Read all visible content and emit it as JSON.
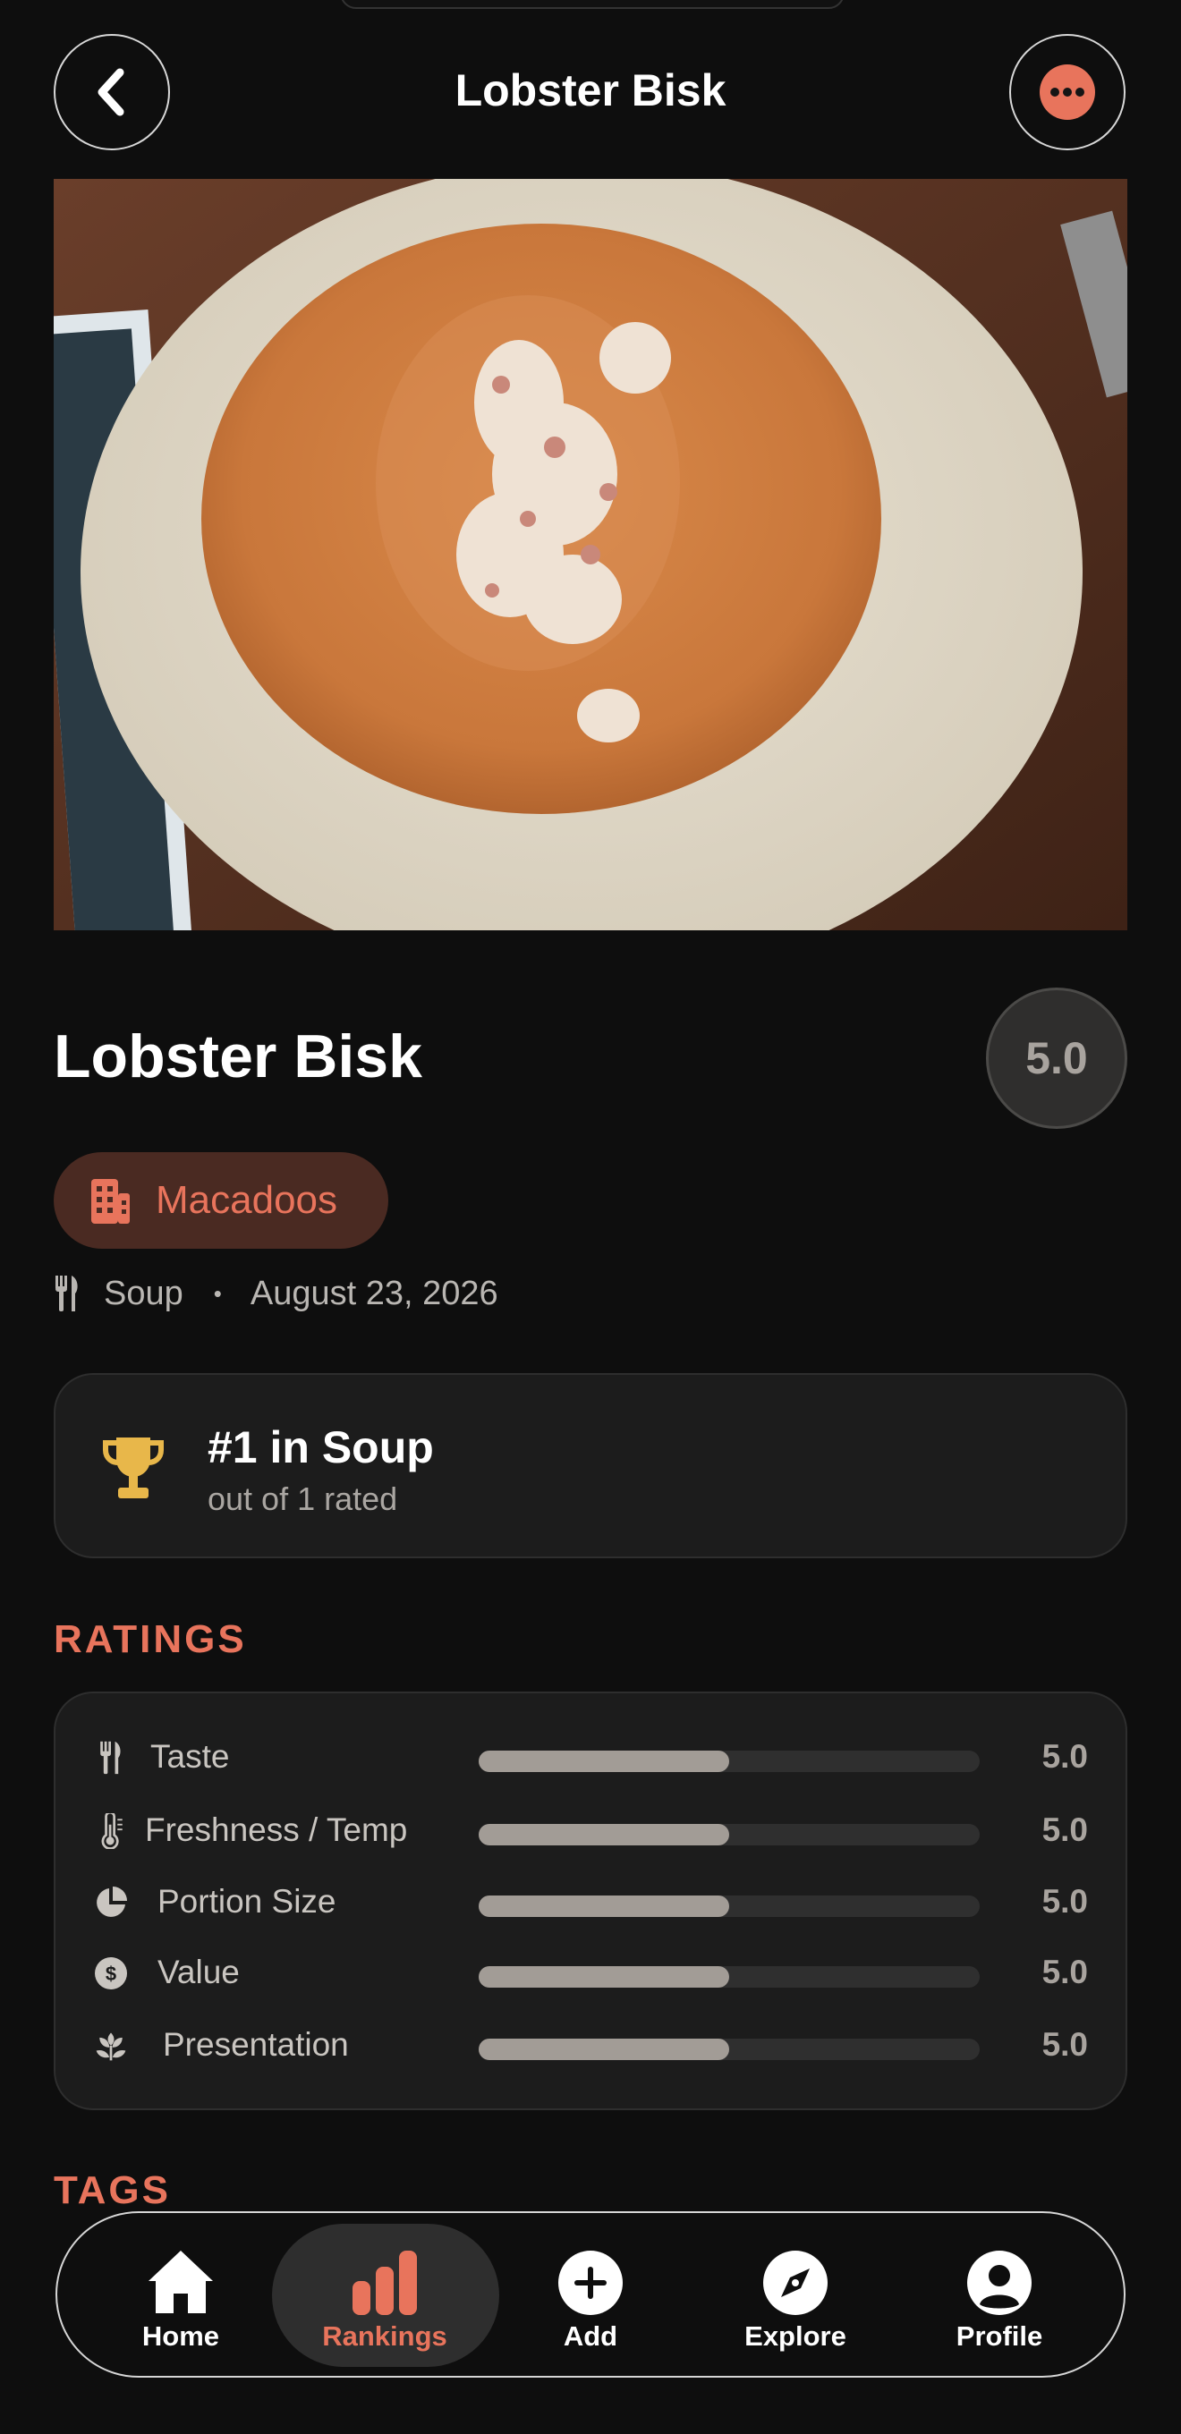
{
  "header": {
    "title": "Lobster Bisk",
    "back_icon": "chevron-left-icon",
    "more_icon": "ellipsis-icon"
  },
  "photo": {
    "description_icon": "food-photo"
  },
  "dish": {
    "name": "Lobster Bisk",
    "score": "5.0"
  },
  "place": {
    "name": "Macadoos",
    "icon": "building-icon"
  },
  "meta": {
    "category": "Soup",
    "separator": "•",
    "date": "August 23, 2026"
  },
  "ranking": {
    "title": "#1 in Soup",
    "subtitle": "out of 1 rated"
  },
  "ratings": {
    "heading": "RATINGS",
    "items": [
      {
        "label": "Taste",
        "value": "5.0",
        "fraction": 0.5,
        "icon": "fork-knife-icon"
      },
      {
        "label": "Freshness / Temp",
        "value": "5.0",
        "fraction": 0.5,
        "icon": "thermometer-icon"
      },
      {
        "label": "Portion Size",
        "value": "5.0",
        "fraction": 0.5,
        "icon": "pie-chart-icon"
      },
      {
        "label": "Value",
        "value": "5.0",
        "fraction": 0.5,
        "icon": "dollar-icon"
      },
      {
        "label": "Presentation",
        "value": "5.0",
        "fraction": 0.5,
        "icon": "flower-icon"
      }
    ]
  },
  "tags": {
    "heading": "TAGS"
  },
  "tabbar": {
    "tabs": [
      {
        "label": "Home",
        "icon": "home-icon"
      },
      {
        "label": "Rankings",
        "icon": "bar-chart-icon",
        "active": true
      },
      {
        "label": "Add",
        "icon": "plus-circle-icon"
      },
      {
        "label": "Explore",
        "icon": "compass-icon"
      },
      {
        "label": "Profile",
        "icon": "person-icon"
      }
    ]
  },
  "colors": {
    "accent": "#e8745c",
    "background": "#0e0e0e",
    "card": "#1c1c1c",
    "bar_fill": "#a29c96",
    "trophy": "#e8b74a"
  }
}
